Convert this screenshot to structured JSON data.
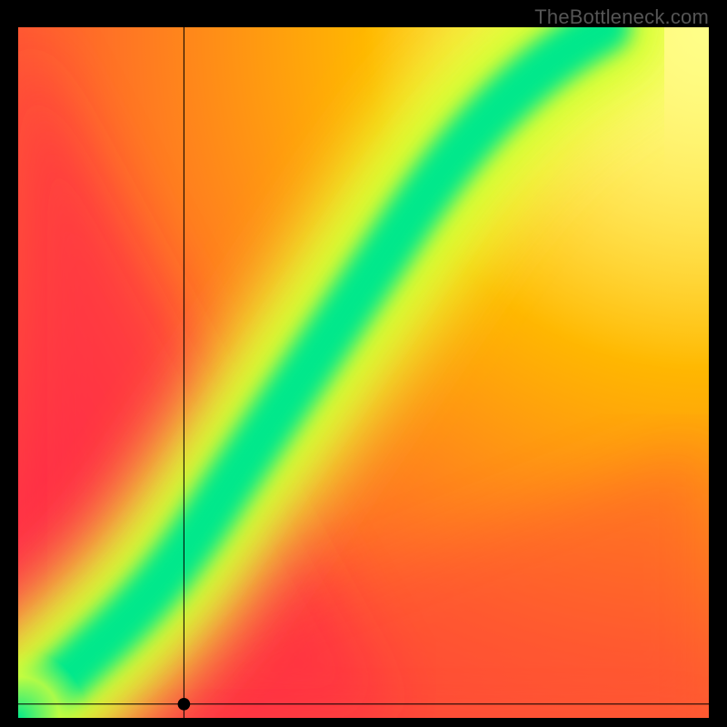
{
  "watermark": "TheBottleneck.com",
  "chart_data": {
    "type": "heatmap",
    "title": "",
    "xlabel": "",
    "ylabel": "",
    "xlim": [
      0,
      100
    ],
    "ylim": [
      0,
      100
    ],
    "color_scale": "red-yellow-green (green=best, red=worst)",
    "description": "Continuous 2D heatmap. A green optimal ridge runs from origin steeply upward (roughly y ≈ 0.7x + 0.012x^2 in normalized 0–100 coords), surrounded by yellow transition, fading to orange/red away from the ridge. Top-right corner is yellow; bottom-left away from ridge is deep red/pink.",
    "axes_lines": {
      "vertical_line_x": 24,
      "horizontal_line_y": 2
    },
    "marker_point": {
      "x": 24,
      "y": 2
    },
    "ridge_samples": [
      {
        "x": 0,
        "y": 0
      },
      {
        "x": 5,
        "y": 5
      },
      {
        "x": 10,
        "y": 9
      },
      {
        "x": 20,
        "y": 20
      },
      {
        "x": 30,
        "y": 33
      },
      {
        "x": 40,
        "y": 47
      },
      {
        "x": 50,
        "y": 60
      },
      {
        "x": 60,
        "y": 73
      },
      {
        "x": 70,
        "y": 85
      },
      {
        "x": 80,
        "y": 95
      },
      {
        "x": 85,
        "y": 100
      }
    ],
    "colors": {
      "best": "#00E88B",
      "good": "#9BE800",
      "mid": "#FFE500",
      "warm": "#FF9A00",
      "bad": "#FF2A55"
    }
  }
}
